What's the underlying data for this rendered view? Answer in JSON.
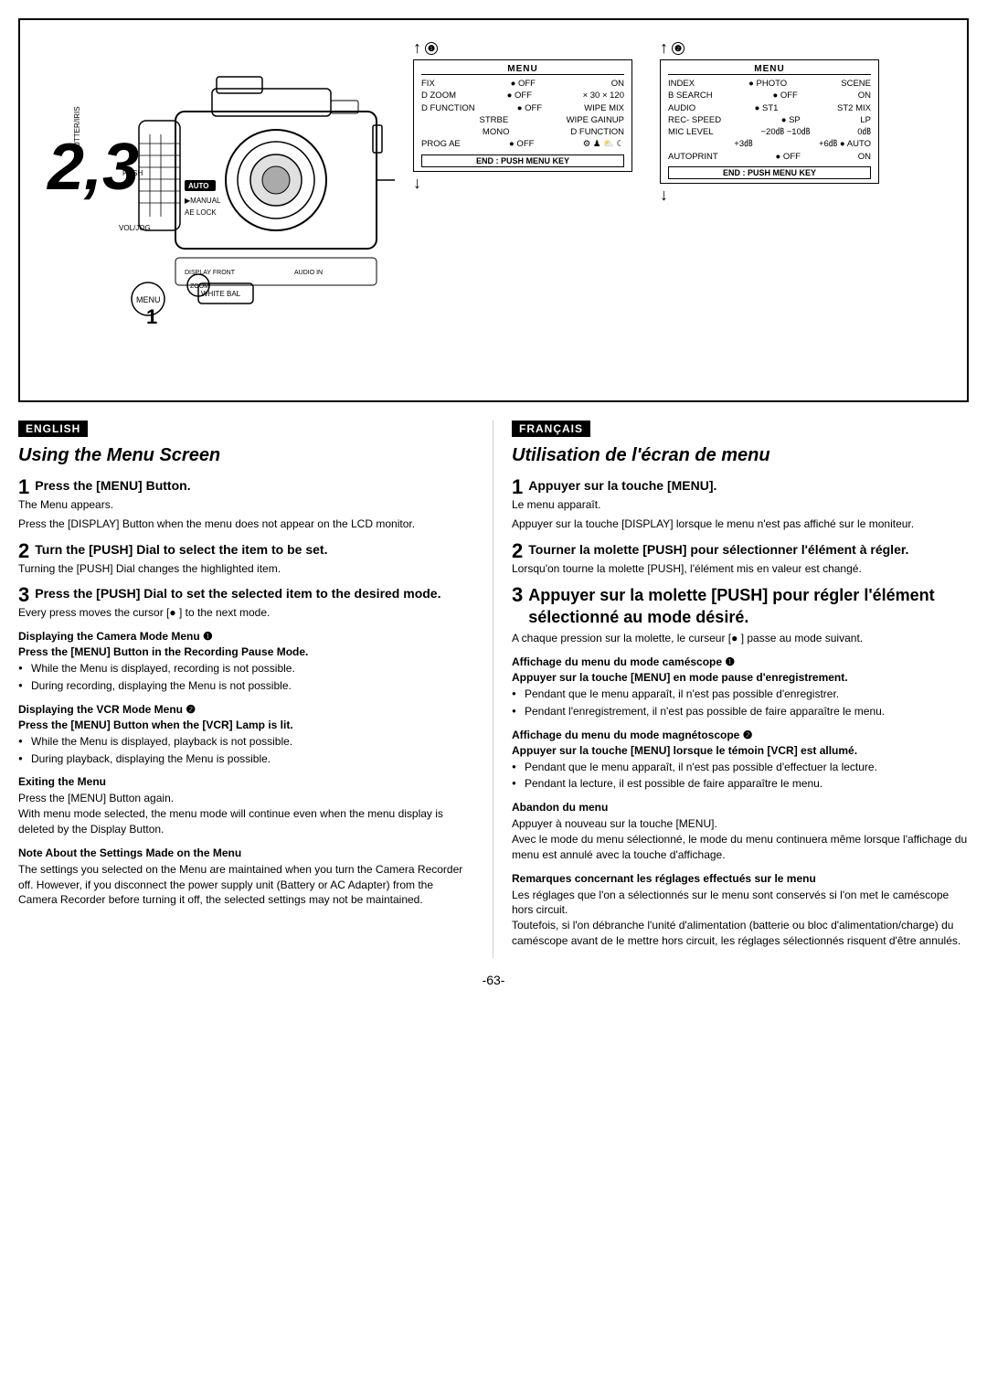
{
  "diagram": {
    "big_number": "2,3",
    "label_1": "1",
    "circle1": "❶",
    "circle2": "❷",
    "menu1": {
      "title": "MENU",
      "rows": [
        {
          "label": "FIX",
          "val1": "● OFF",
          "val2": "ON"
        },
        {
          "label": "D ZOOM",
          "val1": "● OFF",
          "val2": "× 30 × 120"
        },
        {
          "label": "D FUNCTION",
          "val1": "● OFF",
          "val2": "WIPE  MIX"
        },
        {
          "label": "",
          "val1": "STRBE",
          "val2": "WIPE  GAINUP"
        },
        {
          "label": "",
          "val1": "MONO",
          "val2": "D FUNCTION"
        },
        {
          "label": "PROG AE",
          "val1": "● OFF",
          "val2": "🌟 🏃 🌅 🌛"
        },
        {
          "label": "",
          "val1": "",
          "val2": ""
        }
      ],
      "footer": "END : PUSH MENU KEY"
    },
    "menu2": {
      "title": "MENU",
      "rows": [
        {
          "label": "INDEX",
          "val1": "● PHOTO",
          "val2": "SCENE"
        },
        {
          "label": "B SEARCH",
          "val1": "● OFF",
          "val2": "ON"
        },
        {
          "label": "AUDIO",
          "val1": "● ST1",
          "val2": "ST2  MIX"
        },
        {
          "label": "REC- SPEED",
          "val1": "● SP",
          "val2": "LP"
        },
        {
          "label": "MIC LEVEL",
          "val1": "− 20㏈  −10㏈",
          "val2": "0㏈"
        },
        {
          "label": "",
          "val1": "+3㏈",
          "val2": "+6㏈ ● AUTO"
        },
        {
          "label": "AUTOPRINT",
          "val1": "● OFF",
          "val2": "ON"
        }
      ],
      "footer": "END : PUSH MENU KEY"
    }
  },
  "labels": {
    "shutter_iris": "SHUTTER/IRIS",
    "auto": "AUTO",
    "manual": "MANUAL",
    "ae_lock": "AE LOCK",
    "push": "PUSH",
    "vol_jog": "VOL/JOG",
    "menu": "MENU",
    "white_bal": "WHITE BAL"
  },
  "english": {
    "lang_label": "ENGLISH",
    "section_title": "Using the Menu Screen",
    "step1": {
      "number": "1",
      "heading": "Press the [MENU] Button.",
      "body1": "The Menu appears.",
      "body2": "Press the [DISPLAY] Button when the menu does not appear on the LCD monitor."
    },
    "step2": {
      "number": "2",
      "heading": "Turn the [PUSH] Dial to select the item to be set.",
      "body": "Turning the [PUSH] Dial changes the highlighted item."
    },
    "step3": {
      "number": "3",
      "heading": "Press the [PUSH] Dial to set the selected item to the desired mode.",
      "body": "Every press moves the cursor [● ] to the next mode."
    },
    "camera_mode_title": "Displaying the Camera Mode Menu ❶",
    "camera_mode_sub": "Press the [MENU] Button in the Recording Pause Mode.",
    "camera_mode_bullets": [
      "While the Menu is displayed, recording is not possible.",
      "During recording, displaying the Menu is not possible."
    ],
    "vcr_mode_title": "Displaying the VCR Mode Menu ❷",
    "vcr_mode_sub": "Press the [MENU] Button when the [VCR] Lamp is lit.",
    "vcr_mode_bullets": [
      "While the Menu is displayed, playback is not possible.",
      "During playback, displaying the Menu is possible."
    ],
    "exit_title": "Exiting the Menu",
    "exit_body": "Press the [MENU] Button again.\nWith menu mode selected, the menu mode will continue even when the menu display is deleted by the Display Button.",
    "note_title": "Note About the Settings Made on the Menu",
    "note_body": "The settings you selected on the Menu are maintained when you turn the Camera Recorder off. However, if you disconnect the power supply unit (Battery or AC Adapter) from the Camera Recorder before turning it off, the selected settings may not be maintained."
  },
  "francais": {
    "lang_label": "FRANÇAIS",
    "section_title": "Utilisation de l'écran de menu",
    "step1": {
      "number": "1",
      "heading": "Appuyer sur la touche [MENU].",
      "body1": "Le menu apparaît.",
      "body2": "Appuyer sur la touche [DISPLAY] lorsque le menu n'est pas affiché sur le moniteur."
    },
    "step2": {
      "number": "2",
      "heading": "Tourner la molette [PUSH] pour sélectionner l'élément à régler.",
      "body": "Lorsqu'on tourne la molette [PUSH], l'élément mis en valeur est changé."
    },
    "step3": {
      "number": "3",
      "heading": "Appuyer sur la molette [PUSH] pour régler l'élément sélectionné au mode désiré.",
      "body": "A chaque pression sur la molette, le curseur [● ] passe au mode suivant."
    },
    "camera_mode_title": "Affichage du menu du mode caméscope ❶",
    "camera_mode_sub": "Appuyer sur la touche [MENU] en mode pause d'enregistrement.",
    "camera_mode_bullets": [
      "Pendant que le menu apparaît, il n'est pas possible d'enregistrer.",
      "Pendant l'enregistrement, il n'est pas possible de faire apparaître le menu."
    ],
    "vcr_mode_title": "Affichage du menu du mode magnétoscope ❷",
    "vcr_mode_sub": "Appuyer sur la touche [MENU] lorsque le témoin [VCR] est allumé.",
    "vcr_mode_bullets": [
      "Pendant que le menu apparaît, il n'est pas possible d'effectuer la lecture.",
      "Pendant la lecture, il est possible de faire apparaître le menu."
    ],
    "exit_title": "Abandon du menu",
    "exit_body": "Appuyer à nouveau sur la touche [MENU].\nAvec le mode du menu sélectionné, le mode du menu continuera même lorsque l'affichage du menu est annulé avec la touche d'affichage.",
    "note_title": "Remarques concernant les réglages effectués sur le menu",
    "note_body": "Les réglages que l'on a sélectionnés sur le menu sont conservés si l'on met le caméscope hors circuit.\nToutefois, si l'on débranche l'unité d'alimentation (batterie ou bloc d'alimentation/charge) du caméscope avant de le mettre hors circuit, les réglages sélectionnés risquent d'être annulés."
  },
  "page_number": "-63-"
}
